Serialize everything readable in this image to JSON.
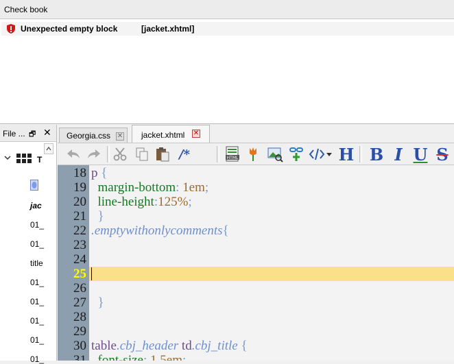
{
  "checkbook": {
    "title": "Check book",
    "error": {
      "message": "Unexpected empty block",
      "file": "[jacket.xhtml]"
    }
  },
  "file_panel": {
    "title": "File ...",
    "float_glyph": "🗗",
    "close_glyph": "✕",
    "tree_root_label": "T",
    "items": [
      "jac",
      "01_",
      "01_",
      "title",
      "01_",
      "01_",
      "01_",
      "01_",
      "01_"
    ]
  },
  "tabs": [
    {
      "label": "Georgia.css",
      "active": false
    },
    {
      "label": "jacket.xhtml",
      "active": true
    }
  ],
  "toolbar": {
    "comment_label": "/*",
    "heading_label": "H",
    "bold_label": "B",
    "italic_label": "I",
    "underline_label": "U",
    "strike_label": "S"
  },
  "editor": {
    "current_line": 25,
    "lines": [
      {
        "n": "18",
        "tokens": [
          {
            "c": "sel",
            "t": "p"
          },
          {
            "c": "punc",
            "t": " {"
          }
        ]
      },
      {
        "n": "19",
        "tokens": [
          {
            "c": "prop",
            "t": "  margin-bottom"
          },
          {
            "c": "punc",
            "t": ":"
          },
          {
            "c": "val",
            "t": " 1em"
          },
          {
            "c": "punc",
            "t": ";"
          }
        ]
      },
      {
        "n": "20",
        "tokens": [
          {
            "c": "prop",
            "t": "  line-height"
          },
          {
            "c": "punc",
            "t": ":"
          },
          {
            "c": "val",
            "t": "125%"
          },
          {
            "c": "punc",
            "t": ";"
          }
        ]
      },
      {
        "n": "21",
        "tokens": [
          {
            "c": "punc",
            "t": "  }"
          }
        ]
      },
      {
        "n": "22",
        "tokens": [
          {
            "c": "cls",
            "t": ".emptywithonlycomments"
          },
          {
            "c": "punc",
            "t": "{"
          }
        ]
      },
      {
        "n": "23",
        "tokens": []
      },
      {
        "n": "24",
        "tokens": []
      },
      {
        "n": "25",
        "tokens": []
      },
      {
        "n": "26",
        "tokens": []
      },
      {
        "n": "27",
        "tokens": [
          {
            "c": "punc",
            "t": "  }"
          }
        ]
      },
      {
        "n": "28",
        "tokens": []
      },
      {
        "n": "29",
        "tokens": []
      },
      {
        "n": "30",
        "tokens": [
          {
            "c": "sel",
            "t": "table"
          },
          {
            "c": "cls",
            "t": ".cbj_header"
          },
          {
            "c": "sel",
            "t": " td"
          },
          {
            "c": "cls",
            "t": ".cbj_title"
          },
          {
            "c": "punc",
            "t": " {"
          }
        ]
      },
      {
        "n": "31",
        "tokens": [
          {
            "c": "prop",
            "t": "  font-size"
          },
          {
            "c": "punc",
            "t": ":"
          },
          {
            "c": "val",
            "t": " 1.5em"
          },
          {
            "c": "punc",
            "t": ";"
          }
        ]
      }
    ]
  },
  "colors": {
    "gutter": "#8d9eaf",
    "current_line_highlight": "#fbe08a",
    "current_line_number": "#ffff00",
    "error_icon": "#d01818"
  }
}
